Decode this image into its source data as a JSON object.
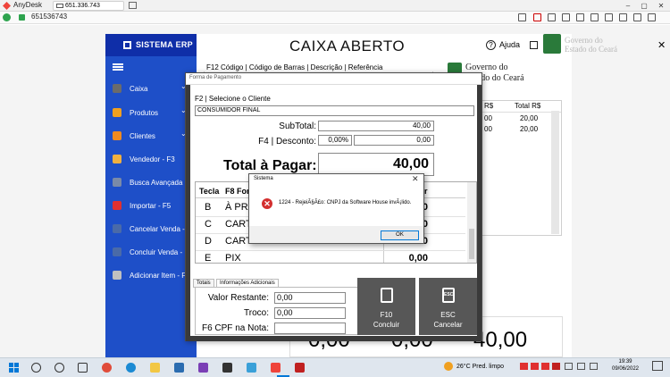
{
  "anydesk": {
    "title": "AnyDesk",
    "tab_address": "651.336.743",
    "remote_id": "651536743",
    "win_controls": [
      "–",
      "▢",
      "✕"
    ]
  },
  "app": {
    "brand": "SISTEMA ERP",
    "title": "CAIXA ABERTO",
    "help_label": "Ajuda",
    "close": "✕",
    "help_icon": "?"
  },
  "sidebar": {
    "items": [
      {
        "label": "Caixa",
        "arrow": "⌄",
        "color": "#6b6b6b"
      },
      {
        "label": "Produtos",
        "arrow": "⌄",
        "color": "#f0a020"
      },
      {
        "label": "Clientes",
        "arrow": "⌄",
        "color": "#f08a20"
      },
      {
        "label": "Vendedor - F3",
        "arrow": "",
        "color": "#f0b040"
      },
      {
        "label": "Busca Avançada - F4",
        "arrow": "",
        "color": "#7a8aa8"
      },
      {
        "label": "Importar - F5",
        "arrow": "",
        "color": "#e03030"
      },
      {
        "label": "Cancelar Venda - F6",
        "arrow": "",
        "color": "#4a6aa8"
      },
      {
        "label": "Concluir Venda - F7",
        "arrow": "",
        "color": "#4a6aa8"
      },
      {
        "label": "Adicionar Item - F9",
        "arrow": "",
        "color": "#c0c0c0"
      }
    ]
  },
  "main": {
    "search_hint": "F12  Código | Código de Barras | Descrição | Referência",
    "gov_line1": "Governo do",
    "gov_line2": "Estado do Ceará",
    "items_table": {
      "headers": [
        "R$",
        "Total R$"
      ],
      "rows": [
        [
          "00",
          "20,00"
        ],
        [
          "00",
          "20,00"
        ]
      ]
    },
    "bottom_totals": [
      "0,00",
      "0,00",
      "40,00"
    ]
  },
  "payment": {
    "window_title": "Forma de Pagamento",
    "client_label": "F2 | Selecione o Cliente",
    "client_value": "CONSUMIDOR FINAL",
    "subtotal_label": "SubTotal:",
    "subtotal_value": "40,00",
    "discount_label": "F4 | Desconto:",
    "discount_pct": "0,00%",
    "discount_value": "0,00",
    "total_label": "Total à Pagar:",
    "total_value": "40,00",
    "methods_headers": [
      "Tecla",
      "F8 For",
      "r"
    ],
    "methods": [
      {
        "key": "B",
        "name": "À PRA",
        "value": "0"
      },
      {
        "key": "C",
        "name": "CART",
        "value": "0"
      },
      {
        "key": "D",
        "name": "CART",
        "value": "0"
      },
      {
        "key": "E",
        "name": "PIX",
        "value": "0,00"
      }
    ],
    "tabs": [
      "Totais",
      "Informações Adicionais"
    ],
    "remaining_label": "Valor Restante:",
    "remaining_value": "0,00",
    "change_label": "Troco:",
    "change_value": "0,00",
    "cpf_label": "F6 CPF na Nota:",
    "cpf_value": "",
    "btn_conclude_l1": "F10",
    "btn_conclude_l2": "Concluir",
    "btn_cancel_l1": "ESC",
    "btn_cancel_l2": "Cancelar",
    "esc_icon_text": "ESC"
  },
  "error": {
    "title": "Sistema",
    "close": "✕",
    "icon": "✕",
    "message": "1224 - RejeiÃ§Ã£o: CNPJ da Software House invÃ¡lido.",
    "ok_label": "OK"
  },
  "taskbar": {
    "weather": "26°C  Pred. limpo",
    "time": "19:39",
    "date": "09/06/2022"
  }
}
